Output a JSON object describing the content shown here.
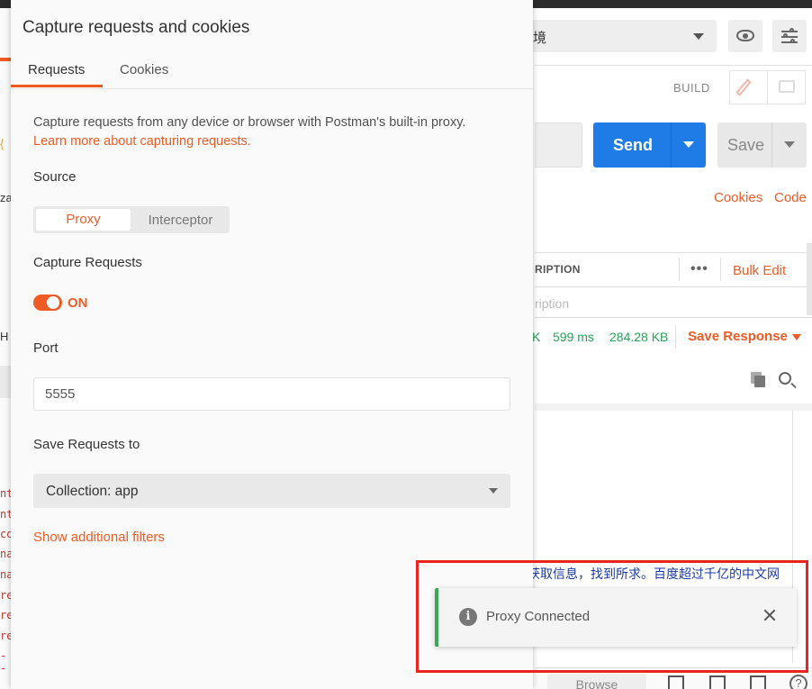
{
  "app": {
    "env_select": "境",
    "build_label": "BUILD",
    "send_label": "Send",
    "save_label": "Save",
    "links": {
      "cookies": "Cookies",
      "code": "Code"
    },
    "params": {
      "desc_header": "RIPTION",
      "more": "•••",
      "bulk_edit": "Bulk Edit",
      "desc_placeholder": "ription"
    },
    "response": {
      "status": "K",
      "time": "599 ms",
      "size": "284.28 KB",
      "save_response": "Save Response"
    },
    "body_text": "获取信息，找到所求。百度超过千亿的中文网",
    "left_fragments": {
      "brace": "{",
      "za": "za",
      "h": "H"
    },
    "code_lines": [
      "nt",
      "nt",
      "co",
      "na",
      "na",
      "re",
      "re",
      "re",
      "--"
    ],
    "browse": "Browse",
    "help": "?"
  },
  "modal": {
    "title": "Capture requests and cookies",
    "tabs": [
      {
        "label": "Requests",
        "active": true
      },
      {
        "label": "Cookies",
        "active": false
      }
    ],
    "description": "Capture requests from any device or browser with Postman's built-in proxy.",
    "learn_more": "Learn more about capturing requests.",
    "source": {
      "label": "Source",
      "options": [
        "Proxy",
        "Interceptor"
      ],
      "selected": "Proxy"
    },
    "capture": {
      "label": "Capture Requests",
      "state": "ON",
      "enabled": true
    },
    "port": {
      "label": "Port",
      "value": "5555"
    },
    "save_to": {
      "label": "Save Requests to",
      "value": "Collection: app"
    },
    "filters_link": "Show additional filters"
  },
  "toast": {
    "message": "Proxy Connected",
    "icon": "info-icon"
  },
  "colors": {
    "accent": "#ef5b25",
    "send_blue": "#1f7ce6",
    "success_green": "#3aa854",
    "highlight_red": "#e8251f"
  }
}
